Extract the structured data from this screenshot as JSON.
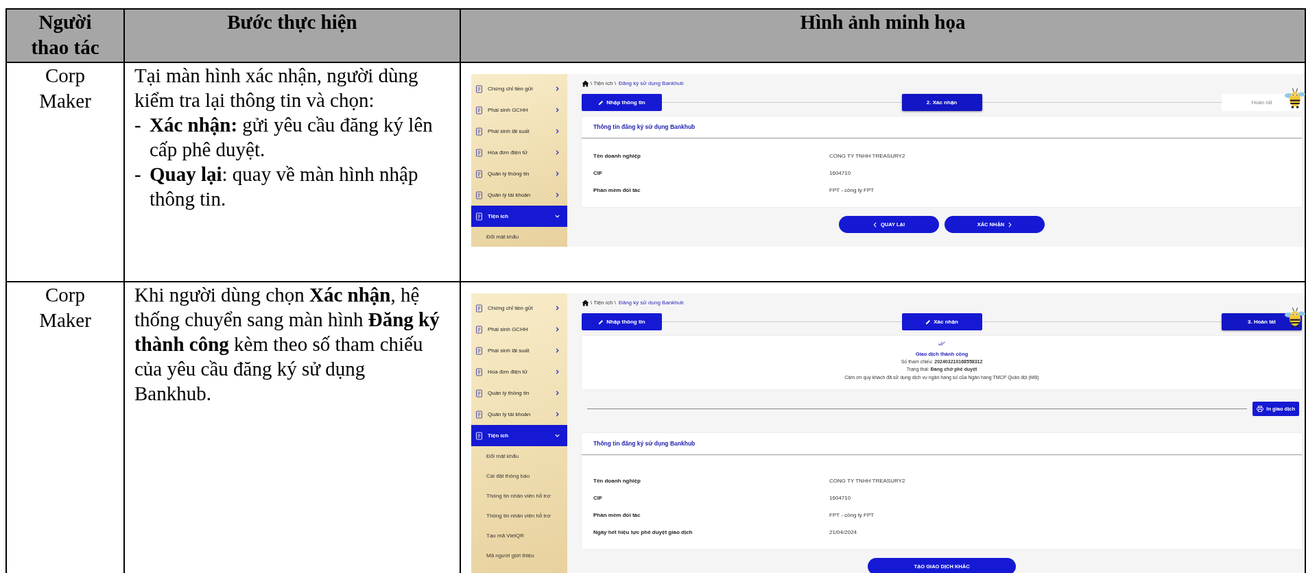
{
  "table": {
    "columns": [
      "Người thao tác",
      "Bước thực hiện",
      "Hình ảnh minh họa"
    ],
    "rows": [
      {
        "actor": "Corp Maker",
        "steps": [
          {
            "kind": "text",
            "text": "Tại màn hình xác nhận, người dùng kiểm tra lại thông tin và chọn:"
          },
          {
            "kind": "bullet",
            "marker": "-",
            "text": "**Xác nhận:** gửi yêu cầu đăng ký lên cấp phê duyệt."
          },
          {
            "kind": "bullet",
            "marker": "-",
            "text": "**Quay lại**: quay về màn hình nhập thông tin."
          }
        ],
        "screen": {
          "sidebar": [
            {
              "label": "Chứng chỉ tiền gửi",
              "selected": false,
              "expanded": false
            },
            {
              "label": "Phái sinh GCHH",
              "selected": false,
              "expanded": false
            },
            {
              "label": "Phái sinh lãi suất",
              "selected": false,
              "expanded": false
            },
            {
              "label": "Hóa đơn điện tử",
              "selected": false,
              "expanded": false
            },
            {
              "label": "Quản lý thông tin",
              "selected": false,
              "expanded": false
            },
            {
              "label": "Quản lý tài khoản",
              "selected": false,
              "expanded": false
            },
            {
              "label": "Tiện ích",
              "selected": true,
              "expanded": true,
              "children": [
                "Đổi mật khẩu"
              ]
            }
          ],
          "breadcrumb": {
            "path": "\\ Tiện ích \\",
            "current": "Đăng ký sử dụng Bankhub"
          },
          "steps": [
            {
              "label": "Nhập thông tin",
              "done": true,
              "selected": false
            },
            {
              "label": "2. Xác nhận",
              "done": false,
              "selected": true
            },
            {
              "label": "Hoàn tất",
              "done": false,
              "selected": false
            }
          ],
          "card": {
            "title": "Thông tin đăng ký sử dụng Bankhub",
            "fields": [
              {
                "label": "Tên doanh nghiệp",
                "value": "CONG TY TNHH TREASURY2"
              },
              {
                "label": "CIF",
                "value": "1604710"
              },
              {
                "label": "Phần mềm đối tác",
                "value": "FPT - công ty FPT"
              }
            ]
          },
          "buttons": [
            {
              "label": "QUAY LẠI",
              "kind": "back"
            },
            {
              "label": "XÁC NHẬN",
              "kind": "forward"
            }
          ]
        }
      },
      {
        "actor": "Corp Maker",
        "steps": [
          {
            "kind": "text",
            "text": "Khi người dùng chọn **Xác nhận**, hệ thống chuyển sang màn hình **Đăng ký thành công** kèm theo số tham chiếu của yêu cầu đăng ký sử dụng Bankhub."
          }
        ],
        "screen": {
          "sidebar": [
            {
              "label": "Chứng chỉ tiền gửi",
              "selected": false,
              "expanded": false
            },
            {
              "label": "Phái sinh GCHH",
              "selected": false,
              "expanded": false
            },
            {
              "label": "Phái sinh lãi suất",
              "selected": false,
              "expanded": false
            },
            {
              "label": "Hóa đơn điện tử",
              "selected": false,
              "expanded": false
            },
            {
              "label": "Quản lý thông tin",
              "selected": false,
              "expanded": false
            },
            {
              "label": "Quản lý tài khoản",
              "selected": false,
              "expanded": false
            },
            {
              "label": "Tiện ích",
              "selected": true,
              "expanded": true,
              "children": [
                "Đổi mật khẩu",
                "Cài đặt thông báo",
                "Thông tin nhân viên hỗ trợ",
                "Thông tin nhân viên hỗ trợ",
                "Tạo mã VietQR",
                "Mã người giới thiệu"
              ]
            }
          ],
          "breadcrumb": {
            "path": "\\ Tiện ích \\",
            "current": "Đăng ký sử dụng Bankhub"
          },
          "steps": [
            {
              "label": "Nhập thông tin",
              "done": true,
              "selected": false
            },
            {
              "label": "Xác nhận",
              "done": true,
              "selected": false
            },
            {
              "label": "3. Hoàn tất",
              "done": false,
              "selected": true
            }
          ],
          "result": {
            "title": "Giao dịch thành công",
            "lines": [
              "Số tham chiếu: **202403210168558312**",
              "Trạng thái: **Đang chờ phê duyệt**",
              "Cảm ơn quý khách đã sử dụng dịch vụ ngân hàng số của Ngân hàng TMCP Quân đội (MB)"
            ]
          },
          "print_button": "In giao dịch",
          "card": {
            "title": "Thông tin đăng ký sử dụng Bankhub",
            "fields": [
              {
                "label": "Tên doanh nghiệp",
                "value": "CONG TY TNHH TREASURY2"
              },
              {
                "label": "CIF",
                "value": "1604710"
              },
              {
                "label": "Phần mềm đối tác",
                "value": "FPT - công ty FPT"
              },
              {
                "label": "Ngày hết hiệu lực phê duyệt giao dịch",
                "value": "21/04/2024"
              }
            ]
          },
          "buttons": [
            {
              "label": "TẠO GIAO DỊCH KHÁC",
              "kind": "action"
            }
          ]
        }
      }
    ]
  }
}
